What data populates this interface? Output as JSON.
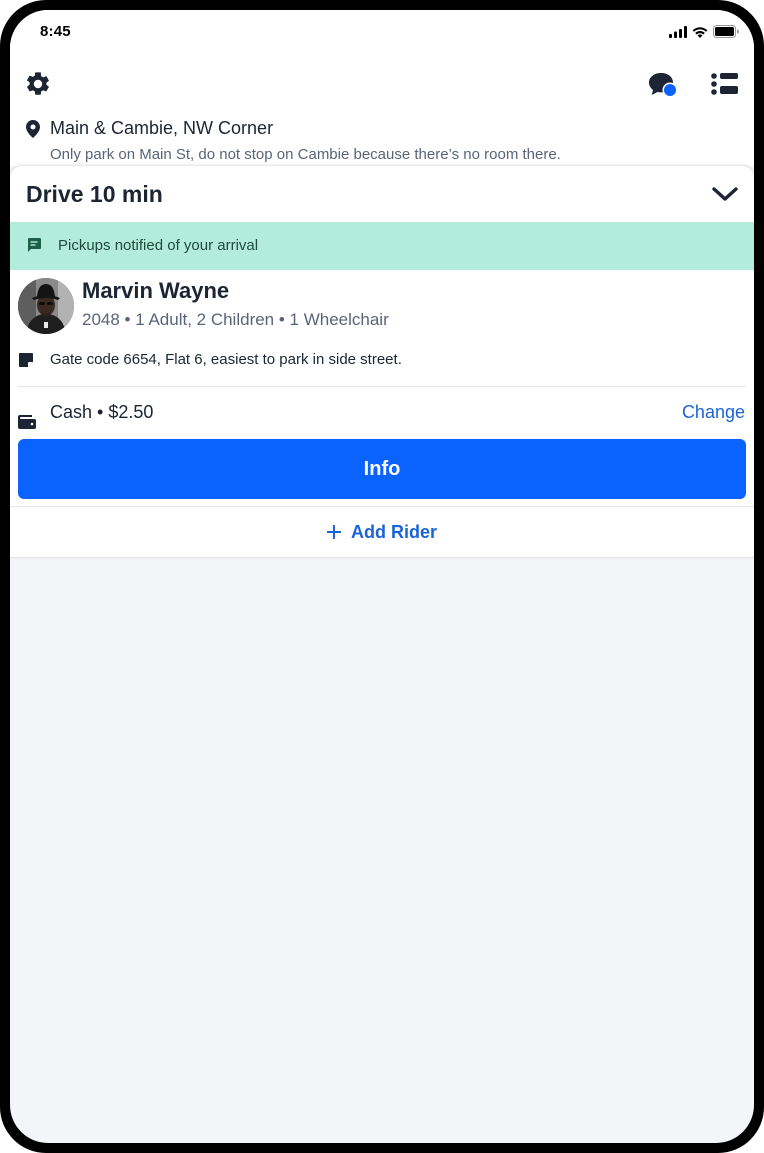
{
  "status_bar": {
    "time": "8:45",
    "icons": [
      "signal-icon",
      "wifi-icon",
      "battery-icon"
    ]
  },
  "header": {
    "icons": [
      "gear-icon",
      "chat-icon",
      "list-icon"
    ],
    "location": {
      "title": "Main & Cambie, NW Corner",
      "note": "Only park on Main St, do not stop on Cambie because there’s no room there."
    }
  },
  "card": {
    "title": "Drive 10 min",
    "banner": {
      "text": "Pickups notified of your arrival",
      "color": "#b4ecdc"
    },
    "rider": {
      "name": "Marvin Wayne",
      "details": "2048 • 1 Adult, 2 Children • 1 Wheelchair"
    },
    "note": "Gate code 6654, Flat 6, easiest to park in side street.",
    "payment": {
      "text": "Cash • $2.50",
      "change_label": "Change"
    },
    "info_button": "Info",
    "add_rider_label": "Add Rider"
  },
  "colors": {
    "accent": "#0a63ff",
    "link": "#1a63d8",
    "notification_dot": "#0a63ff",
    "text_primary": "#1d2433",
    "text_secondary": "#5a6478",
    "background": "#f4f5f9"
  }
}
